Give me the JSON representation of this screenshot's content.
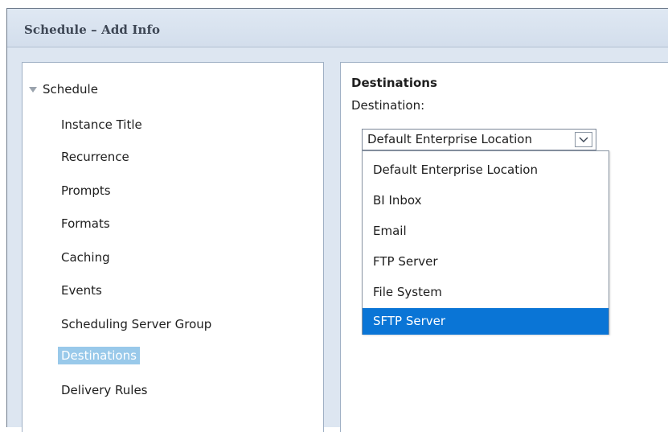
{
  "window": {
    "title": "Schedule – Add Info"
  },
  "tree": {
    "root": "Schedule",
    "items": [
      "Instance Title",
      "Recurrence",
      "Prompts",
      "Formats",
      "Caching",
      "Events",
      "Scheduling Server Group",
      "Destinations",
      "Delivery Rules"
    ],
    "selected": "Destinations"
  },
  "destinations": {
    "section_title": "Destinations",
    "field_label": "Destination:",
    "selected_value": "Default Enterprise Location",
    "options": [
      "Default Enterprise Location",
      "BI Inbox",
      "Email",
      "FTP Server",
      "File System",
      "SFTP Server"
    ],
    "highlighted_option": "SFTP Server"
  },
  "colors": {
    "selection_highlight": "#0a75d6",
    "tree_selection": "#99c9ea",
    "window_background": "#dde6f1"
  },
  "icons": {
    "tree_toggle": "triangle-down-icon",
    "dropdown_arrow": "chevron-down-icon"
  }
}
